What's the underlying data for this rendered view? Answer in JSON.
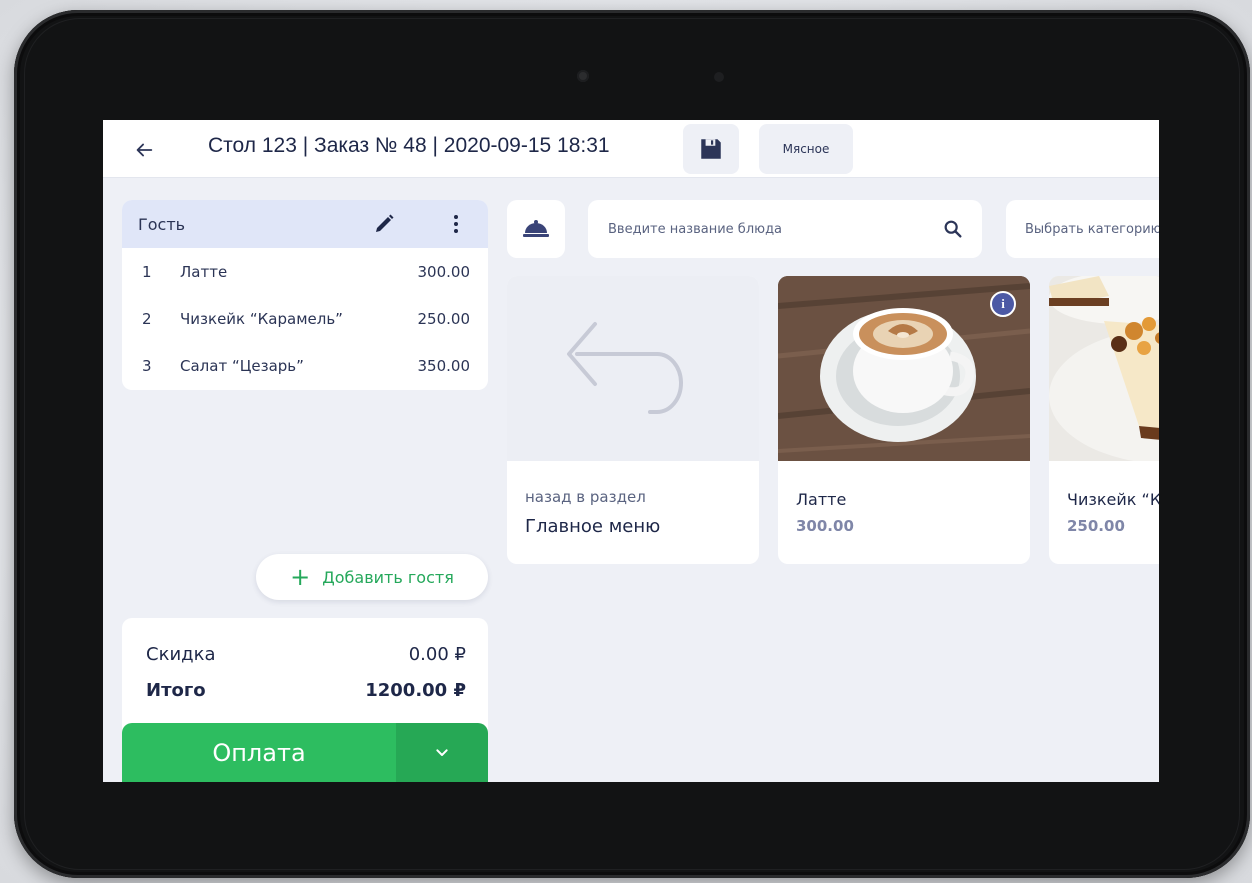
{
  "header": {
    "back_icon": "arrow-left-icon",
    "title": "Стол 123 | Заказ № 48 | 2020-09-15 18:31",
    "save_icon": "floppy-disk-icon",
    "chip_label": "Мясное"
  },
  "guest": {
    "name": "Гость",
    "edit_icon": "pencil-icon",
    "more_icon": "more-vertical-icon",
    "items": [
      {
        "num": "1",
        "name": "Латте",
        "price": "300.00"
      },
      {
        "num": "2",
        "name": "Чизкейк “Карамель”",
        "price": "250.00"
      },
      {
        "num": "3",
        "name": "Салат “Цезарь”",
        "price": "350.00"
      }
    ]
  },
  "add_guest": {
    "icon": "plus-icon",
    "label": "Добавить гостя"
  },
  "totals": {
    "discount_label": "Скидка",
    "discount_value": "0.00 ₽",
    "total_label": "Итого",
    "total_value": "1200.00 ₽"
  },
  "payment": {
    "label": "Оплата",
    "dropdown_icon": "chevron-down-icon"
  },
  "search": {
    "placeholder": "Введите название блюда",
    "icon": "search-icon",
    "cloche_icon": "serving-cloche-icon",
    "category_placeholder": "Выбрать категорию"
  },
  "products": {
    "back": {
      "icon": "undo-arrow-icon",
      "subtitle": "назад в раздел",
      "title": "Главное меню"
    },
    "items": [
      {
        "name": "Латте",
        "price": "300.00",
        "info_icon": "info-icon"
      },
      {
        "name": "Чизкейк “Карамель”",
        "price": "250.00"
      }
    ]
  },
  "colors": {
    "accent_green": "#2dbd60",
    "header_text": "#1e2748",
    "guest_header_bg": "#e0e6f8",
    "screen_bg": "#eef0f6",
    "info_badge": "#4c59a5"
  }
}
